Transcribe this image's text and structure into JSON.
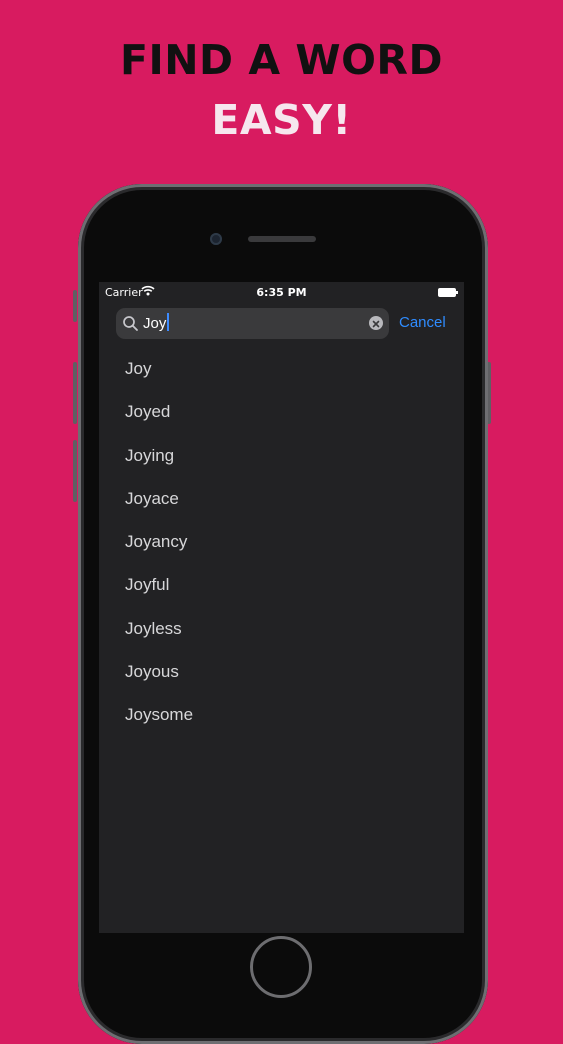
{
  "headline": {
    "line1": "FIND A WORD",
    "line2": "EASY!"
  },
  "status_bar": {
    "carrier": "Carrier",
    "time": "6:35 PM"
  },
  "search": {
    "value": "Joy",
    "cancel_label": "Cancel"
  },
  "results": [
    "Joy",
    "Joyed",
    "Joying",
    "Joyace",
    "Joyancy",
    "Joyful",
    "Joyless",
    "Joyous",
    "Joysome"
  ],
  "colors": {
    "background": "#d81b60",
    "screen": "#222224",
    "accent": "#2f8cff"
  }
}
